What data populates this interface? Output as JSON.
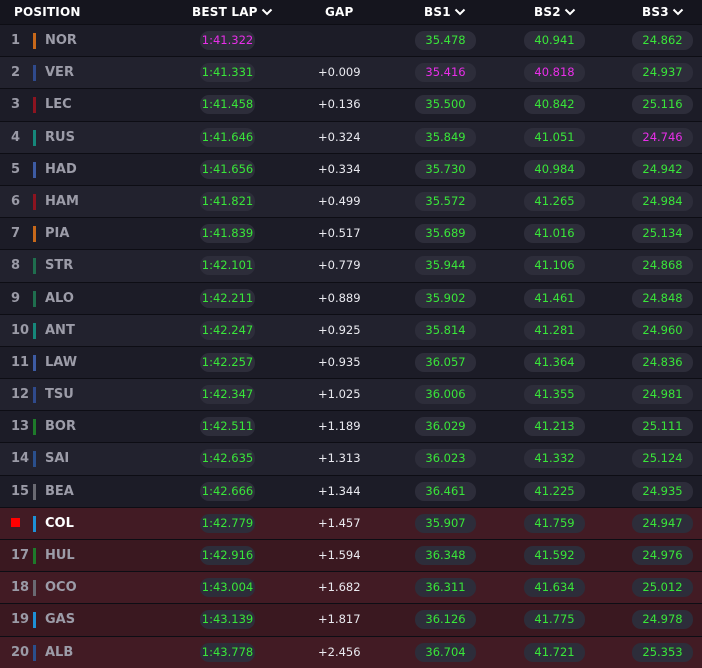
{
  "header": {
    "position": "POSITION",
    "best_lap": "BEST LAP",
    "gap": "GAP",
    "bs1": "BS1",
    "bs2": "BS2",
    "bs3": "BS3"
  },
  "colors": {
    "personal_best": "#39e639",
    "overall_best": "#e92ee9",
    "elimination_zone": "#3a1820",
    "flag": "#ff0000"
  },
  "rows": [
    {
      "pos": "1",
      "code": "NOR",
      "team_color": "#c7681a",
      "best_lap": "1:41.322",
      "lap_color": "p",
      "gap": "",
      "bs1": "35.478",
      "bs1_color": "g",
      "bs2": "40.941",
      "bs2_color": "g",
      "bs3": "24.862",
      "bs3_color": "g"
    },
    {
      "pos": "2",
      "code": "VER",
      "team_color": "#2f4a8c",
      "best_lap": "1:41.331",
      "lap_color": "g",
      "gap": "+0.009",
      "bs1": "35.416",
      "bs1_color": "p",
      "bs2": "40.818",
      "bs2_color": "p",
      "bs3": "24.937",
      "bs3_color": "g"
    },
    {
      "pos": "3",
      "code": "LEC",
      "team_color": "#8c1420",
      "best_lap": "1:41.458",
      "lap_color": "g",
      "gap": "+0.136",
      "bs1": "35.500",
      "bs1_color": "g",
      "bs2": "40.842",
      "bs2_color": "g",
      "bs3": "25.116",
      "bs3_color": "g"
    },
    {
      "pos": "4",
      "code": "RUS",
      "team_color": "#16877a",
      "best_lap": "1:41.646",
      "lap_color": "g",
      "gap": "+0.324",
      "bs1": "35.849",
      "bs1_color": "g",
      "bs2": "41.051",
      "bs2_color": "g",
      "bs3": "24.746",
      "bs3_color": "p"
    },
    {
      "pos": "5",
      "code": "HAD",
      "team_color": "#3d5ba3",
      "best_lap": "1:41.656",
      "lap_color": "g",
      "gap": "+0.334",
      "bs1": "35.730",
      "bs1_color": "g",
      "bs2": "40.984",
      "bs2_color": "g",
      "bs3": "24.942",
      "bs3_color": "g"
    },
    {
      "pos": "6",
      "code": "HAM",
      "team_color": "#8c1420",
      "best_lap": "1:41.821",
      "lap_color": "g",
      "gap": "+0.499",
      "bs1": "35.572",
      "bs1_color": "g",
      "bs2": "41.265",
      "bs2_color": "g",
      "bs3": "24.984",
      "bs3_color": "g"
    },
    {
      "pos": "7",
      "code": "PIA",
      "team_color": "#c7681a",
      "best_lap": "1:41.839",
      "lap_color": "g",
      "gap": "+0.517",
      "bs1": "35.689",
      "bs1_color": "g",
      "bs2": "41.016",
      "bs2_color": "g",
      "bs3": "25.134",
      "bs3_color": "g"
    },
    {
      "pos": "8",
      "code": "STR",
      "team_color": "#1f6e4e",
      "best_lap": "1:42.101",
      "lap_color": "g",
      "gap": "+0.779",
      "bs1": "35.944",
      "bs1_color": "g",
      "bs2": "41.106",
      "bs2_color": "g",
      "bs3": "24.868",
      "bs3_color": "g"
    },
    {
      "pos": "9",
      "code": "ALO",
      "team_color": "#1f6e4e",
      "best_lap": "1:42.211",
      "lap_color": "g",
      "gap": "+0.889",
      "bs1": "35.902",
      "bs1_color": "g",
      "bs2": "41.461",
      "bs2_color": "g",
      "bs3": "24.848",
      "bs3_color": "g"
    },
    {
      "pos": "10",
      "code": "ANT",
      "team_color": "#16877a",
      "best_lap": "1:42.247",
      "lap_color": "g",
      "gap": "+0.925",
      "bs1": "35.814",
      "bs1_color": "g",
      "bs2": "41.281",
      "bs2_color": "g",
      "bs3": "24.960",
      "bs3_color": "g"
    },
    {
      "pos": "11",
      "code": "LAW",
      "team_color": "#3d5ba3",
      "best_lap": "1:42.257",
      "lap_color": "g",
      "gap": "+0.935",
      "bs1": "36.057",
      "bs1_color": "g",
      "bs2": "41.364",
      "bs2_color": "g",
      "bs3": "24.836",
      "bs3_color": "g"
    },
    {
      "pos": "12",
      "code": "TSU",
      "team_color": "#2f4a8c",
      "best_lap": "1:42.347",
      "lap_color": "g",
      "gap": "+1.025",
      "bs1": "36.006",
      "bs1_color": "g",
      "bs2": "41.355",
      "bs2_color": "g",
      "bs3": "24.981",
      "bs3_color": "g"
    },
    {
      "pos": "13",
      "code": "BOR",
      "team_color": "#1e7a2a",
      "best_lap": "1:42.511",
      "lap_color": "g",
      "gap": "+1.189",
      "bs1": "36.029",
      "bs1_color": "g",
      "bs2": "41.213",
      "bs2_color": "g",
      "bs3": "25.111",
      "bs3_color": "g"
    },
    {
      "pos": "14",
      "code": "SAI",
      "team_color": "#2a4f8c",
      "best_lap": "1:42.635",
      "lap_color": "g",
      "gap": "+1.313",
      "bs1": "36.023",
      "bs1_color": "g",
      "bs2": "41.332",
      "bs2_color": "g",
      "bs3": "25.124",
      "bs3_color": "g"
    },
    {
      "pos": "15",
      "code": "BEA",
      "team_color": "#6a6a72",
      "best_lap": "1:42.666",
      "lap_color": "g",
      "gap": "+1.344",
      "bs1": "36.461",
      "bs1_color": "g",
      "bs2": "41.225",
      "bs2_color": "g",
      "bs3": "24.935",
      "bs3_color": "g"
    },
    {
      "pos": "",
      "code": "COL",
      "team_color": "#1e90d6",
      "best_lap": "1:42.779",
      "lap_color": "g",
      "gap": "+1.457",
      "bs1": "35.907",
      "bs1_color": "g",
      "bs2": "41.759",
      "bs2_color": "g",
      "bs3": "24.947",
      "bs3_color": "g",
      "flag": true
    },
    {
      "pos": "17",
      "code": "HUL",
      "team_color": "#1e7a2a",
      "best_lap": "1:42.916",
      "lap_color": "g",
      "gap": "+1.594",
      "bs1": "36.348",
      "bs1_color": "g",
      "bs2": "41.592",
      "bs2_color": "g",
      "bs3": "24.976",
      "bs3_color": "g"
    },
    {
      "pos": "18",
      "code": "OCO",
      "team_color": "#6a6a72",
      "best_lap": "1:43.004",
      "lap_color": "g",
      "gap": "+1.682",
      "bs1": "36.311",
      "bs1_color": "g",
      "bs2": "41.634",
      "bs2_color": "g",
      "bs3": "25.012",
      "bs3_color": "g"
    },
    {
      "pos": "19",
      "code": "GAS",
      "team_color": "#1e90d6",
      "best_lap": "1:43.139",
      "lap_color": "g",
      "gap": "+1.817",
      "bs1": "36.126",
      "bs1_color": "g",
      "bs2": "41.775",
      "bs2_color": "g",
      "bs3": "24.978",
      "bs3_color": "g"
    },
    {
      "pos": "20",
      "code": "ALB",
      "team_color": "#2a4f8c",
      "best_lap": "1:43.778",
      "lap_color": "g",
      "gap": "+2.456",
      "bs1": "36.704",
      "bs1_color": "g",
      "bs2": "41.721",
      "bs2_color": "g",
      "bs3": "25.353",
      "bs3_color": "g"
    }
  ]
}
